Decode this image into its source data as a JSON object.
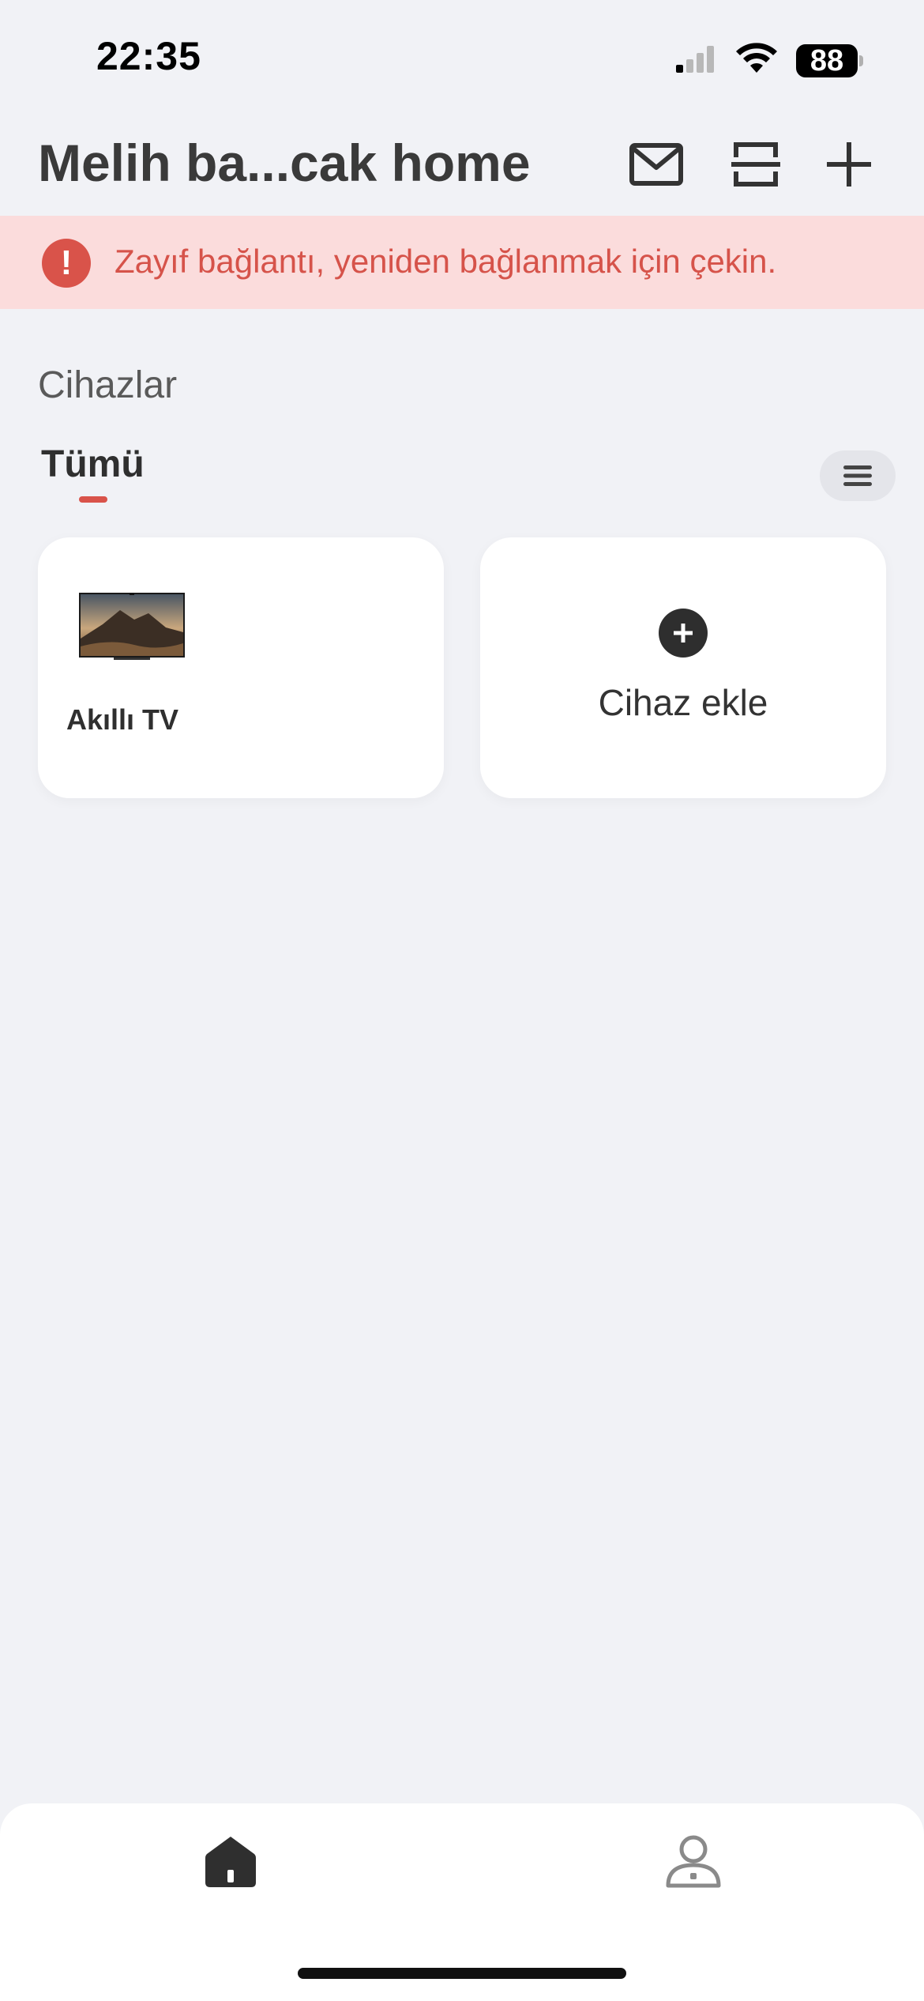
{
  "status_bar": {
    "time": "22:35",
    "battery": "88",
    "icons": [
      "cellular-signal-icon",
      "wifi-icon",
      "battery-icon"
    ]
  },
  "header": {
    "title": "Melih ba...cak home",
    "actions": [
      "mail-icon",
      "scan-icon",
      "plus-icon"
    ]
  },
  "banner": {
    "text": "Zayıf bağlantı, yeniden bağlanmak için çekin.",
    "icon": "alert-icon",
    "color": "#d9534a",
    "background": "#fbdcdc"
  },
  "devices": {
    "section_title": "Cihazlar",
    "tabs": [
      {
        "label": "Tümü",
        "active": true
      }
    ],
    "cards": [
      {
        "name": "Akıllı TV",
        "icon": "tv-thumbnail"
      }
    ],
    "add_card_label": "Cihaz ekle"
  },
  "bottom_nav": {
    "items": [
      {
        "icon": "home-icon",
        "active": true
      },
      {
        "icon": "profile-icon",
        "active": false
      }
    ]
  },
  "colors": {
    "accent": "#d9534a",
    "background": "#f1f2f6",
    "card": "#ffffff"
  }
}
